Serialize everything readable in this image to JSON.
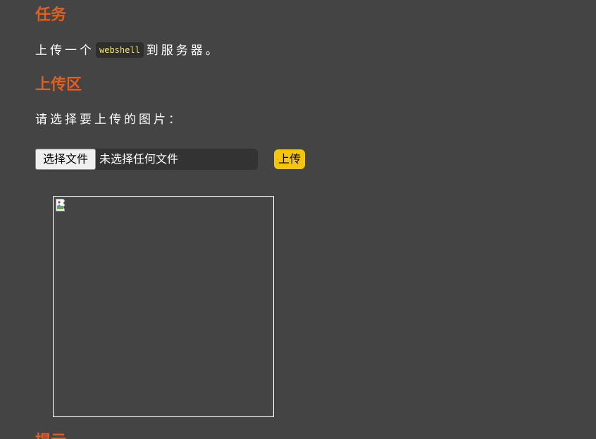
{
  "task": {
    "heading": "任务",
    "text_before": "上传一个",
    "code": "webshell",
    "text_after": "到服务器。"
  },
  "upload": {
    "heading": "上传区",
    "prompt": "请选择要上传的图片：",
    "choose_file_label": "选择文件",
    "no_file_text": "未选择任何文件",
    "submit_label": "上传"
  },
  "tip": {
    "heading": "提示"
  },
  "colors": {
    "background": "#444444",
    "heading": "#e0601c",
    "code_text": "#f5e66b",
    "submit_button": "#f5c50c"
  },
  "icons": {
    "preview": "broken-image-icon"
  }
}
